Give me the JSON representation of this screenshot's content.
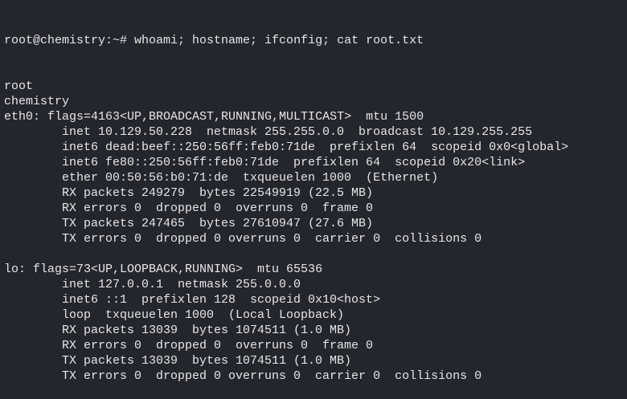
{
  "terminal": {
    "prompt": "root@chemistry:~# ",
    "command": "whoami; hostname; ifconfig; cat root.txt",
    "output": [
      {
        "text": "root",
        "indent": false
      },
      {
        "text": "chemistry",
        "indent": false
      },
      {
        "text": "eth0: flags=4163<UP,BROADCAST,RUNNING,MULTICAST>  mtu 1500",
        "indent": false
      },
      {
        "text": "inet 10.129.50.228  netmask 255.255.0.0  broadcast 10.129.255.255",
        "indent": true
      },
      {
        "text": "inet6 dead:beef::250:56ff:feb0:71de  prefixlen 64  scopeid 0x0<global>",
        "indent": true
      },
      {
        "text": "inet6 fe80::250:56ff:feb0:71de  prefixlen 64  scopeid 0x20<link>",
        "indent": true
      },
      {
        "text": "ether 00:50:56:b0:71:de  txqueuelen 1000  (Ethernet)",
        "indent": true
      },
      {
        "text": "RX packets 249279  bytes 22549919 (22.5 MB)",
        "indent": true
      },
      {
        "text": "RX errors 0  dropped 0  overruns 0  frame 0",
        "indent": true
      },
      {
        "text": "TX packets 247465  bytes 27610947 (27.6 MB)",
        "indent": true
      },
      {
        "text": "TX errors 0  dropped 0 overruns 0  carrier 0  collisions 0",
        "indent": true
      },
      {
        "text": "",
        "indent": false
      },
      {
        "text": "lo: flags=73<UP,LOOPBACK,RUNNING>  mtu 65536",
        "indent": false
      },
      {
        "text": "inet 127.0.0.1  netmask 255.0.0.0",
        "indent": true
      },
      {
        "text": "inet6 ::1  prefixlen 128  scopeid 0x10<host>",
        "indent": true
      },
      {
        "text": "loop  txqueuelen 1000  (Local Loopback)",
        "indent": true
      },
      {
        "text": "RX packets 13039  bytes 1074511 (1.0 MB)",
        "indent": true
      },
      {
        "text": "RX errors 0  dropped 0  overruns 0  frame 0",
        "indent": true
      },
      {
        "text": "TX packets 13039  bytes 1074511 (1.0 MB)",
        "indent": true
      },
      {
        "text": "TX errors 0  dropped 0 overruns 0  carrier 0  collisions 0",
        "indent": true
      }
    ]
  }
}
